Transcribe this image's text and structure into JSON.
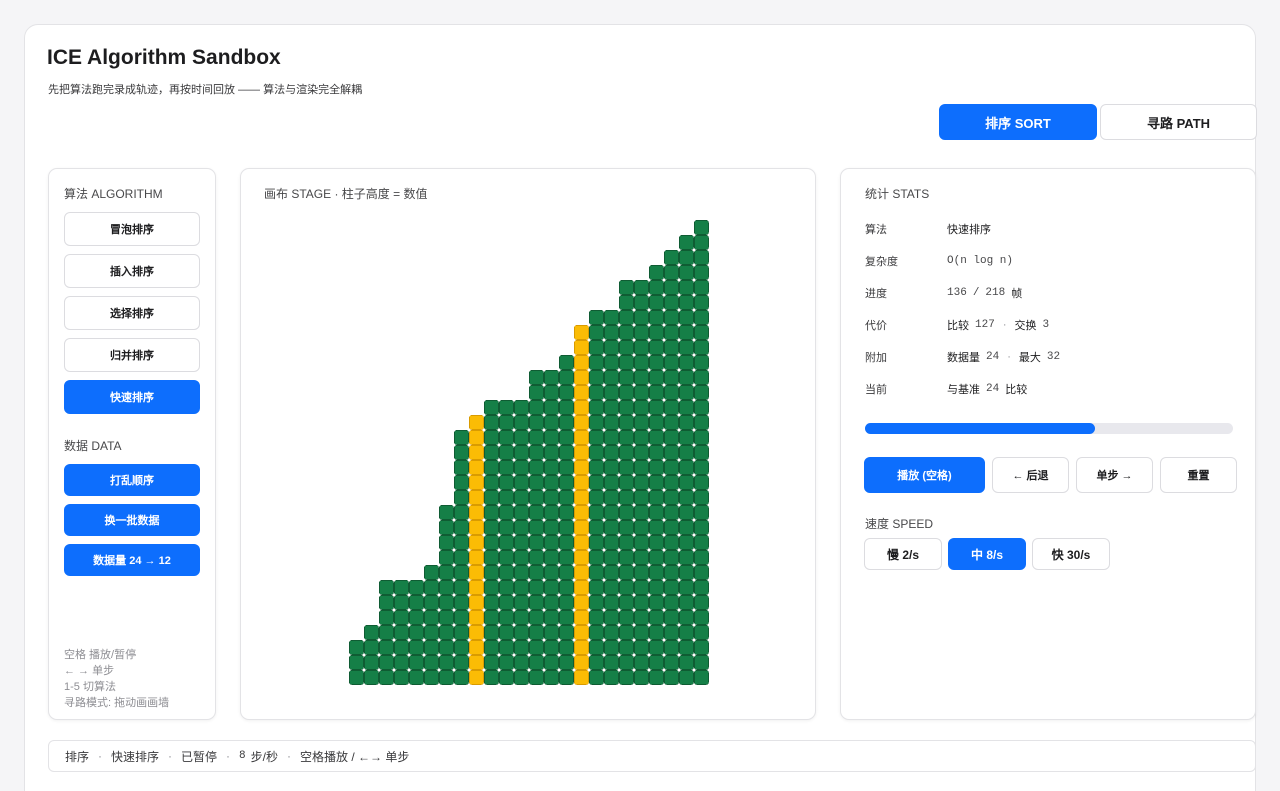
{
  "app": {
    "title": "ICE Algorithm Sandbox",
    "subtitle": "先把算法跑完录成轨迹，再按时间回放 —— 算法与渲染完全解耦"
  },
  "modes": [
    {
      "label": "排序 SORT",
      "active": true
    },
    {
      "label": "寻路 PATH",
      "active": false
    }
  ],
  "left_panel": {
    "algorithm_title": "算法 ALGORITHM",
    "algorithms": [
      {
        "label": "冒泡排序",
        "active": false
      },
      {
        "label": "插入排序",
        "active": false
      },
      {
        "label": "选择排序",
        "active": false
      },
      {
        "label": "归并排序",
        "active": false
      },
      {
        "label": "快速排序",
        "active": true
      }
    ],
    "data_title": "数据 DATA",
    "data_buttons": [
      {
        "label": "打乱顺序"
      },
      {
        "label": "换一批数据"
      },
      {
        "label": "数据量 24 → 12"
      }
    ],
    "hints": [
      "空格 播放/暂停",
      "← → 单步",
      "1-5 切算法",
      "寻路模式: 拖动画画墙"
    ]
  },
  "stage": {
    "title": "画布 STAGE · 柱子高度 = 数值",
    "colors": {
      "normal": "#157f47",
      "highlight": "#fbbc05"
    }
  },
  "chart_data": {
    "type": "bar",
    "values": [
      3,
      4,
      7,
      7,
      7,
      8,
      12,
      17,
      18,
      19,
      19,
      19,
      21,
      21,
      22,
      24,
      25,
      25,
      27,
      27,
      28,
      29,
      30,
      31
    ],
    "highlighted_indices": [
      8,
      15
    ],
    "ylim": [
      0,
      32
    ]
  },
  "stats": {
    "title": "统计 STATS",
    "algorithm_label": "算法",
    "algorithm_value": "快速排序",
    "complexity_label": "复杂度",
    "complexity_value": "O(n log n)",
    "progress_label": "进度",
    "progress_current": "136",
    "progress_slash": "/",
    "progress_total": "218",
    "progress_unit": "帧",
    "progress_fraction": 0.624,
    "cost_label": "代价",
    "compare_label": "比较",
    "compare_value": "127",
    "swap_label": "交换",
    "swap_value": "3",
    "extra_label": "附加",
    "size_label": "数据量",
    "size_value": "24",
    "max_label": "最大",
    "max_value": "32",
    "current_label": "当前",
    "current_prefix": "与基准",
    "current_value": "24",
    "current_suffix": "比较"
  },
  "controls": {
    "play": "播放 (空格)",
    "back": "← 后退",
    "step": "单步 →",
    "reset": "重置"
  },
  "speed": {
    "title": "速度 SPEED",
    "options": [
      {
        "label": "慢 2/s",
        "active": false
      },
      {
        "label": "中 8/s",
        "active": true
      },
      {
        "label": "快 30/s",
        "active": false
      }
    ]
  },
  "status_bar": {
    "mode": "排序",
    "algorithm": "快速排序",
    "state": "已暂停",
    "speed_value": "8",
    "speed_unit": "步/秒",
    "hint": "空格播放 / ←→ 单步"
  },
  "colors": {
    "accent": "#0d6efd",
    "bar_normal": "#157f47",
    "bar_highlight": "#fbbc05"
  }
}
